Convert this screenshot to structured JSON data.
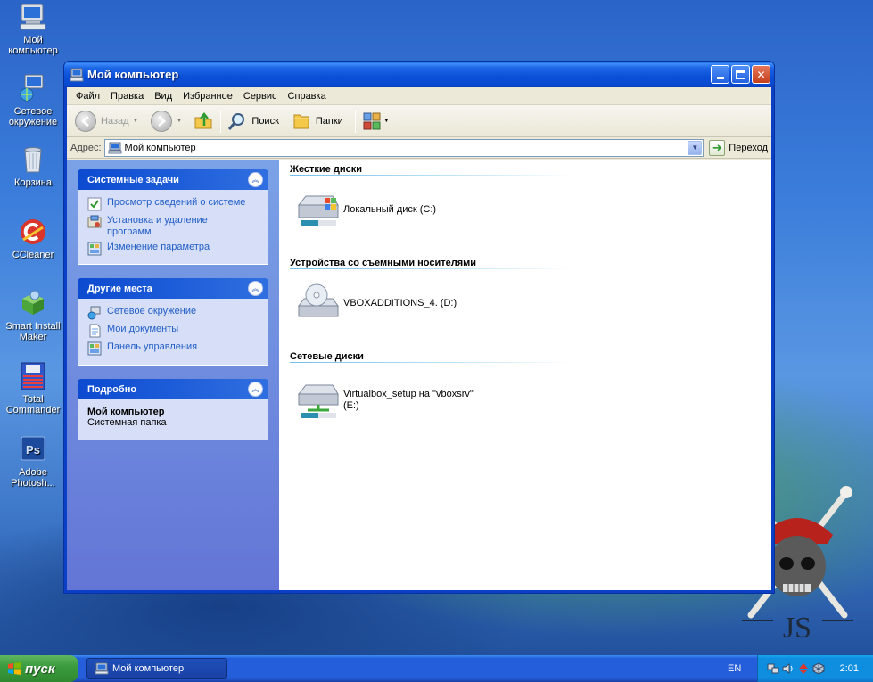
{
  "desktop": {
    "icons": [
      {
        "label": "Мой\nкомпьютер",
        "icon": "my-computer-icon"
      },
      {
        "label": "Сетевое\nокружение",
        "icon": "network-places-icon"
      },
      {
        "label": "Корзина",
        "icon": "recycle-bin-icon"
      },
      {
        "label": "CCleaner",
        "icon": "ccleaner-icon"
      },
      {
        "label": "Smart Install\nMaker",
        "icon": "smart-install-maker-icon"
      },
      {
        "label": "Total\nCommander",
        "icon": "total-commander-icon"
      },
      {
        "label": "Adobe\nPhotosh...",
        "icon": "photoshop-icon"
      }
    ],
    "watermark_text": "JS"
  },
  "window": {
    "title": "Мой компьютер",
    "menu": [
      "Файл",
      "Правка",
      "Вид",
      "Избранное",
      "Сервис",
      "Справка"
    ],
    "toolbar": {
      "back_label": "Назад",
      "search_label": "Поиск",
      "folders_label": "Папки"
    },
    "address": {
      "label": "Адрес:",
      "value": "Мой компьютер",
      "go_label": "Переход"
    },
    "taskpane": {
      "system_tasks": {
        "title": "Системные задачи",
        "items": [
          {
            "label": "Просмотр сведений о системе",
            "icon": "system-info-icon"
          },
          {
            "label": "Установка и удаление программ",
            "icon": "add-remove-programs-icon"
          },
          {
            "label": "Изменение параметра",
            "icon": "control-panel-icon"
          }
        ]
      },
      "other_places": {
        "title": "Другие места",
        "items": [
          {
            "label": "Сетевое окружение",
            "icon": "network-places-icon"
          },
          {
            "label": "Мои документы",
            "icon": "my-documents-icon"
          },
          {
            "label": "Панель управления",
            "icon": "control-panel-icon"
          }
        ]
      },
      "details": {
        "title": "Подробно",
        "name": "Мой компьютер",
        "type": "Системная папка"
      }
    },
    "groups": [
      {
        "header": "Жесткие диски",
        "items": [
          {
            "label": "Локальный диск (C:)",
            "icon": "hard-drive-icon"
          }
        ]
      },
      {
        "header": "Устройства со съемными носителями",
        "items": [
          {
            "label": "VBOXADDITIONS_4. (D:)",
            "icon": "cd-drive-icon"
          }
        ]
      },
      {
        "header": "Сетевые диски",
        "items": [
          {
            "label": "Virtualbox_setup на \"vboxsrv\"\n(E:)",
            "icon": "network-drive-icon"
          }
        ]
      }
    ]
  },
  "taskbar": {
    "start_label": "пуск",
    "task_label": "Мой компьютер",
    "lang": "EN",
    "clock": "2:01"
  }
}
